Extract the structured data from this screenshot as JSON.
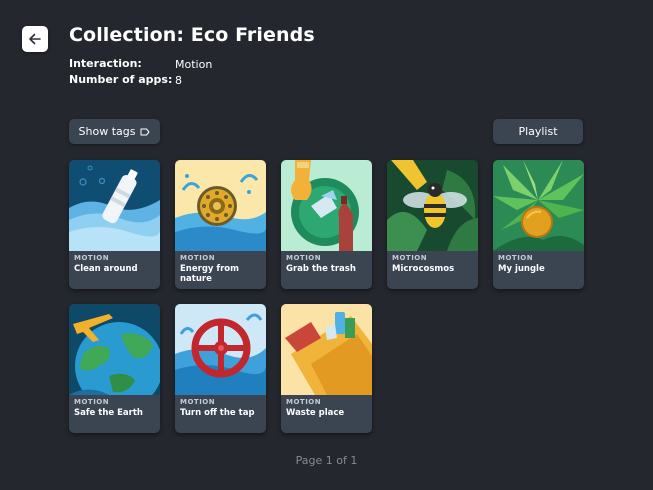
{
  "header": {
    "title": "Collection: Eco Friends",
    "interaction_label": "Interaction:",
    "interaction_value": "Motion",
    "count_label": "Number of apps:",
    "count_value": "8"
  },
  "toolbar": {
    "show_tags_label": "Show tags",
    "playlist_label": "Playlist"
  },
  "apps": [
    {
      "category": "MOTION",
      "name": "Clean around"
    },
    {
      "category": "MOTION",
      "name": "Energy from nature"
    },
    {
      "category": "MOTION",
      "name": "Grab the trash"
    },
    {
      "category": "MOTION",
      "name": "Microcosmos"
    },
    {
      "category": "MOTION",
      "name": "My jungle"
    },
    {
      "category": "MOTION",
      "name": "Safe the Earth"
    },
    {
      "category": "MOTION",
      "name": "Turn off the tap"
    },
    {
      "category": "MOTION",
      "name": "Waste place"
    }
  ],
  "pagination": {
    "text": "Page 1 of 1"
  },
  "colors": {
    "background": "#24272d",
    "card": "#3b4451",
    "button": "#3b4451"
  }
}
